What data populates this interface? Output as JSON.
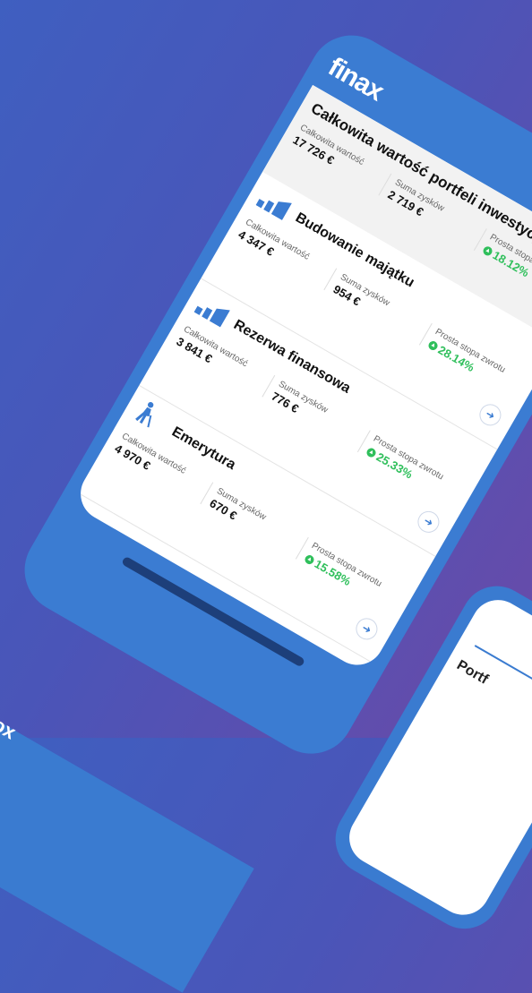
{
  "app": {
    "logo": "finax"
  },
  "summary": {
    "title": "Całkowita wartość portfeli inwestycyjnych",
    "total_label": "Całkowita wartość",
    "total_value": "17 726 €",
    "profit_label": "Suma zysków",
    "profit_value": "2 719 €",
    "return_label": "Prosta stopa zwrotu",
    "return_value": "18.12%"
  },
  "portfolios": [
    {
      "name": "Budowanie majątku",
      "icon": "bar-chart-icon",
      "total_label": "Całkowita wartość",
      "total_value": "4 347 €",
      "profit_label": "Suma zysków",
      "profit_value": "954 €",
      "return_label": "Prosta stopa zwrotu",
      "return_value": "28.14%"
    },
    {
      "name": "Rezerwa finansowa",
      "icon": "bar-chart-icon",
      "total_label": "Całkowita wartość",
      "total_value": "3 841 €",
      "profit_label": "Suma zysków",
      "profit_value": "776 €",
      "return_label": "Prosta stopa zwrotu",
      "return_value": "25.33%"
    },
    {
      "name": "Emerytura",
      "icon": "elderly-person-icon",
      "total_label": "Całkowita wartość",
      "total_value": "4 970 €",
      "profit_label": "Suma zysków",
      "profit_value": "670 €",
      "return_label": "Prosta stopa zwrotu",
      "return_value": "15.58%"
    }
  ],
  "second_phone": {
    "label": "Portf"
  },
  "background_text": "ox",
  "colors": {
    "brand": "#3b7cd2",
    "positive": "#2fbf5b",
    "background": "#4a55b8"
  }
}
